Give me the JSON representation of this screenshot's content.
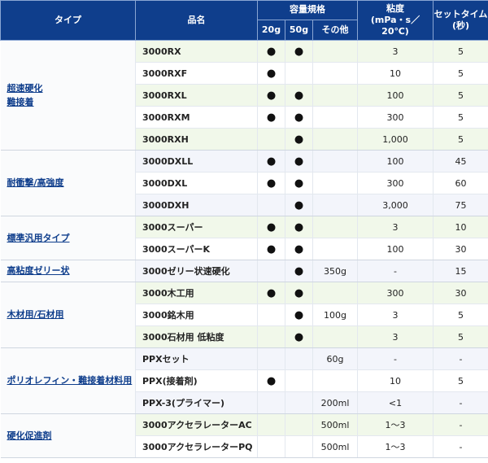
{
  "headers": {
    "type": "タイプ",
    "name": "品名",
    "capacity": "容量規格",
    "cap_20g": "20g",
    "cap_50g": "50g",
    "cap_other": "その他",
    "viscosity_line1": "粘度",
    "viscosity_line2": "(mPa・s／20℃)",
    "settime_line1": "セットタイム",
    "settime_line2": "(秒)"
  },
  "groups": [
    {
      "type_lines": [
        "超速硬化",
        "難接着"
      ],
      "rows": [
        {
          "name": "3000RX",
          "g20": "●",
          "g50": "●",
          "other": "",
          "viscosity": "3",
          "settime": "5"
        },
        {
          "name": "3000RXF",
          "g20": "●",
          "g50": "",
          "other": "",
          "viscosity": "10",
          "settime": "5"
        },
        {
          "name": "3000RXL",
          "g20": "●",
          "g50": "●",
          "other": "",
          "viscosity": "100",
          "settime": "5"
        },
        {
          "name": "3000RXM",
          "g20": "●",
          "g50": "●",
          "other": "",
          "viscosity": "300",
          "settime": "5"
        },
        {
          "name": "3000RXH",
          "g20": "",
          "g50": "●",
          "other": "",
          "viscosity": "1,000",
          "settime": "5"
        }
      ]
    },
    {
      "type_lines": [
        "耐衝撃/高強度"
      ],
      "rows": [
        {
          "name": "3000DXLL",
          "g20": "●",
          "g50": "●",
          "other": "",
          "viscosity": "100",
          "settime": "45"
        },
        {
          "name": "3000DXL",
          "g20": "●",
          "g50": "●",
          "other": "",
          "viscosity": "300",
          "settime": "60"
        },
        {
          "name": "3000DXH",
          "g20": "",
          "g50": "●",
          "other": "",
          "viscosity": "3,000",
          "settime": "75"
        }
      ]
    },
    {
      "type_lines": [
        "標準汎用タイプ"
      ],
      "rows": [
        {
          "name": "3000スーパー",
          "g20": "●",
          "g50": "●",
          "other": "",
          "viscosity": "3",
          "settime": "10"
        },
        {
          "name": "3000スーパーK",
          "g20": "●",
          "g50": "●",
          "other": "",
          "viscosity": "100",
          "settime": "30"
        }
      ]
    },
    {
      "type_lines": [
        "高粘度ゼリー状"
      ],
      "rows": [
        {
          "name": "3000ゼリー状速硬化",
          "g20": "",
          "g50": "●",
          "other": "350g",
          "viscosity": "-",
          "settime": "15"
        }
      ]
    },
    {
      "type_lines": [
        "木材用/石材用"
      ],
      "rows": [
        {
          "name": "3000木工用",
          "g20": "●",
          "g50": "●",
          "other": "",
          "viscosity": "300",
          "settime": "30"
        },
        {
          "name": "3000銘木用",
          "g20": "",
          "g50": "●",
          "other": "100g",
          "viscosity": "3",
          "settime": "5"
        },
        {
          "name": "3000石材用 低粘度",
          "g20": "",
          "g50": "●",
          "other": "",
          "viscosity": "3",
          "settime": "5"
        }
      ]
    },
    {
      "type_lines": [
        "ポリオレフィン・難接着材料用"
      ],
      "rows": [
        {
          "name": "PPXセット",
          "g20": "",
          "g50": "",
          "other": "60g",
          "viscosity": "-",
          "settime": "-"
        },
        {
          "name": "PPX(接着剤)",
          "g20": "●",
          "g50": "",
          "other": "",
          "viscosity": "10",
          "settime": "5"
        },
        {
          "name": "PPX-3(プライマー)",
          "g20": "",
          "g50": "",
          "other": "200ml",
          "viscosity": "<1",
          "settime": "-"
        }
      ]
    },
    {
      "type_lines": [
        "硬化促進剤"
      ],
      "rows": [
        {
          "name": "3000アクセラレーターAC",
          "g20": "",
          "g50": "",
          "other": "500ml",
          "viscosity": "1〜3",
          "settime": "-"
        },
        {
          "name": "3000アクセラレーターPQ",
          "g20": "",
          "g50": "",
          "other": "500ml",
          "viscosity": "1〜3",
          "settime": "-"
        }
      ]
    }
  ]
}
